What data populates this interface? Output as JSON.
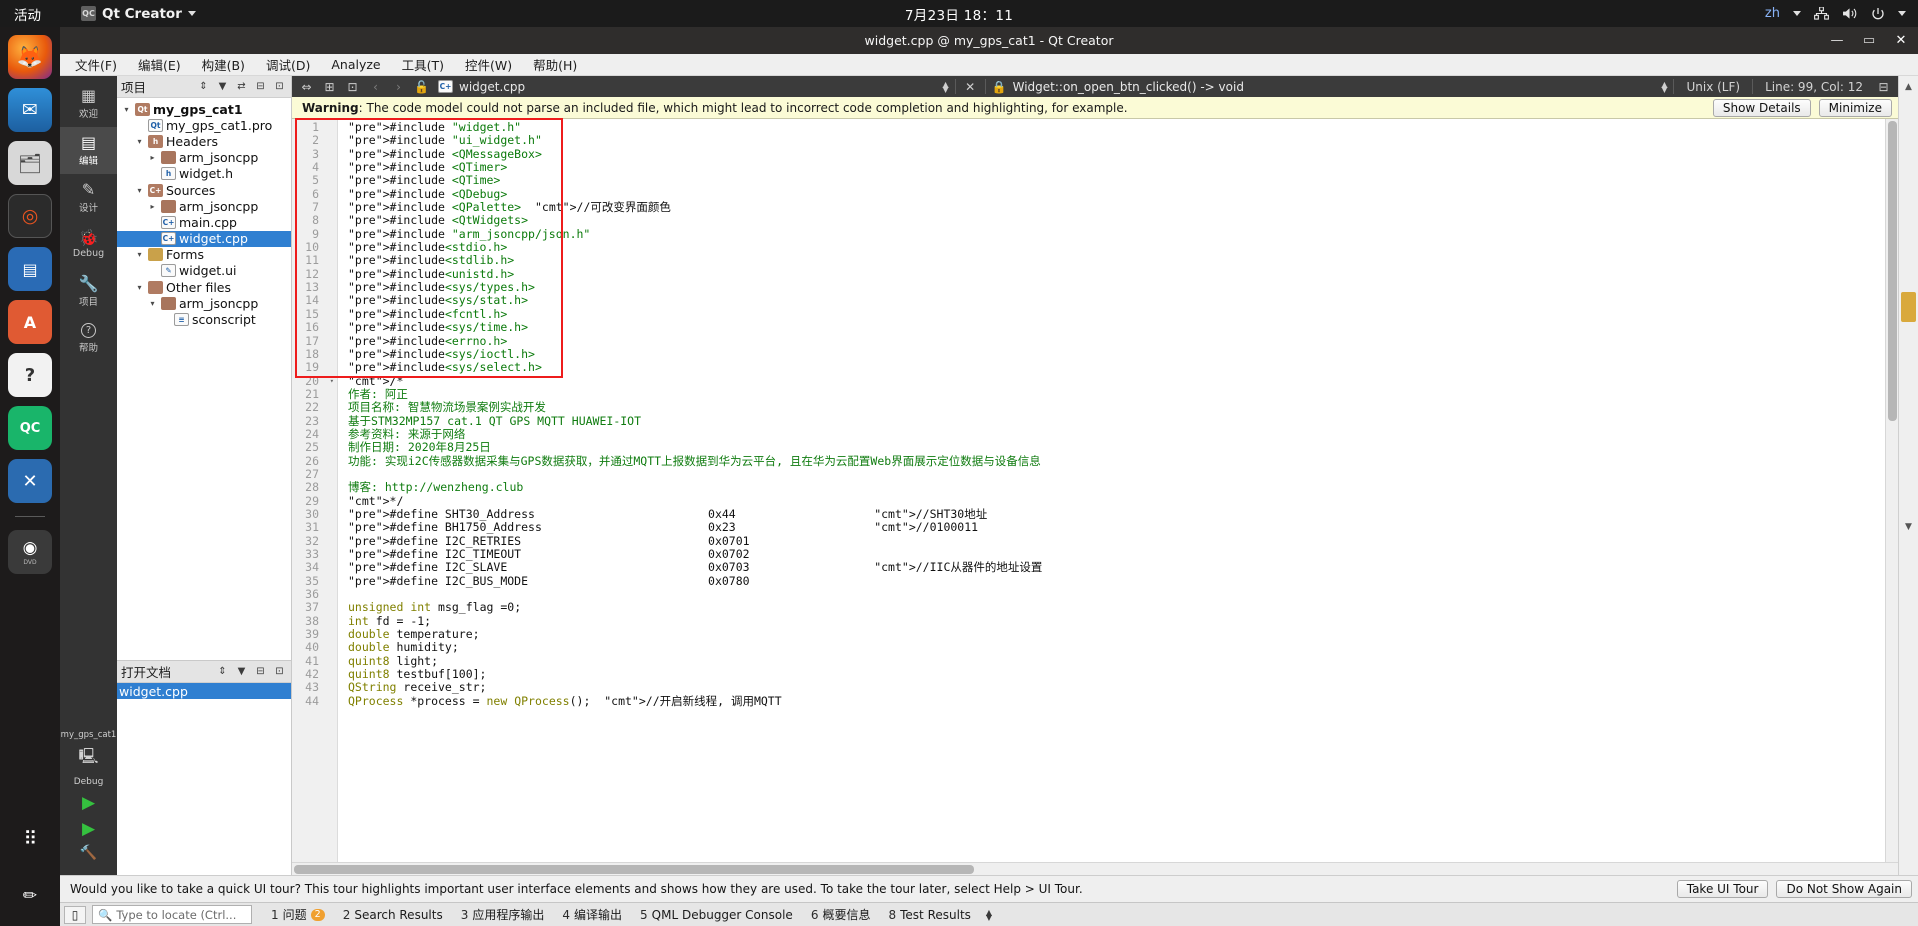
{
  "gnome": {
    "activities": "活动",
    "app_name": "Qt Creator",
    "app_badge": "QC",
    "clock": "7月23日  18：11",
    "language": "zh",
    "icons": [
      "network-icon",
      "volume-icon",
      "power-icon",
      "caret-down-icon"
    ]
  },
  "dock": {
    "items": [
      {
        "name": "firefox",
        "glyph": "🦊"
      },
      {
        "name": "thunderbird",
        "glyph": "✉"
      },
      {
        "name": "files",
        "glyph": "🗂"
      },
      {
        "name": "rhythmbox",
        "glyph": "◎"
      },
      {
        "name": "libreoffice-writer",
        "glyph": "📄"
      },
      {
        "name": "ubuntu-software",
        "glyph": "Ａ"
      },
      {
        "name": "help",
        "glyph": "?"
      },
      {
        "name": "qt-creator",
        "glyph": "QC"
      },
      {
        "name": "vscode",
        "glyph": "✕"
      },
      {
        "name": "dvd-drive",
        "glyph": "◉"
      },
      {
        "name": "show-applications",
        "glyph": "⠿"
      }
    ],
    "dvd_label": "DVD"
  },
  "window": {
    "title": "widget.cpp @ my_gps_cat1 - Qt Creator",
    "buttons": {
      "minimize": "—",
      "maximize": "▭",
      "close": "✕"
    }
  },
  "menubar": [
    {
      "label": "文件(F)",
      "key": "F"
    },
    {
      "label": "编辑(E)",
      "key": "E"
    },
    {
      "label": "构建(B)",
      "key": "B"
    },
    {
      "label": "调试(D)",
      "key": "D"
    },
    {
      "label": "Analyze",
      "key": "A"
    },
    {
      "label": "工具(T)",
      "key": "T"
    },
    {
      "label": "控件(W)",
      "key": "W"
    },
    {
      "label": "帮助(H)",
      "key": "H"
    }
  ],
  "modebar": [
    {
      "label": "欢迎",
      "glyph": "▦",
      "active": false
    },
    {
      "label": "编辑",
      "glyph": "▤",
      "active": true
    },
    {
      "label": "设计",
      "glyph": "✎",
      "active": false
    },
    {
      "label": "Debug",
      "glyph": "🐞",
      "active": false
    },
    {
      "label": "项目",
      "glyph": "🔧",
      "active": false
    },
    {
      "label": "帮助",
      "glyph": "?",
      "active": false
    }
  ],
  "project_panel": {
    "title": "项目",
    "header_icons": [
      "sort-icon",
      "filter-icon",
      "link-icon",
      "split-icon",
      "close-icon"
    ],
    "tree": [
      {
        "label": "my_gps_cat1",
        "indent": 0,
        "arrow": "▾",
        "icon": "folder",
        "icon_text": "Qt",
        "bold": true,
        "selected": false
      },
      {
        "label": "my_gps_cat1.pro",
        "indent": 1,
        "arrow": "",
        "icon": "file",
        "icon_text": "Qt",
        "bold": false,
        "selected": false
      },
      {
        "label": "Headers",
        "indent": 1,
        "arrow": "▾",
        "icon": "folder",
        "icon_text": "h",
        "bold": false,
        "selected": false
      },
      {
        "label": "arm_jsoncpp",
        "indent": 2,
        "arrow": "▸",
        "icon": "folder-plain",
        "icon_text": "",
        "bold": false,
        "selected": false
      },
      {
        "label": "widget.h",
        "indent": 2,
        "arrow": "",
        "icon": "file",
        "icon_text": "h",
        "bold": false,
        "selected": false
      },
      {
        "label": "Sources",
        "indent": 1,
        "arrow": "▾",
        "icon": "folder",
        "icon_text": "C+",
        "bold": false,
        "selected": false
      },
      {
        "label": "arm_jsoncpp",
        "indent": 2,
        "arrow": "▸",
        "icon": "folder-plain",
        "icon_text": "",
        "bold": false,
        "selected": false
      },
      {
        "label": "main.cpp",
        "indent": 2,
        "arrow": "",
        "icon": "file",
        "icon_text": "C+",
        "bold": false,
        "selected": false
      },
      {
        "label": "widget.cpp",
        "indent": 2,
        "arrow": "",
        "icon": "file",
        "icon_text": "C+",
        "bold": false,
        "selected": true
      },
      {
        "label": "Forms",
        "indent": 1,
        "arrow": "▾",
        "icon": "folder-form",
        "icon_text": "",
        "bold": false,
        "selected": false
      },
      {
        "label": "widget.ui",
        "indent": 2,
        "arrow": "",
        "icon": "file",
        "icon_text": "✎",
        "bold": false,
        "selected": false
      },
      {
        "label": "Other files",
        "indent": 1,
        "arrow": "▾",
        "icon": "folder",
        "icon_text": "",
        "bold": false,
        "selected": false
      },
      {
        "label": "arm_jsoncpp",
        "indent": 2,
        "arrow": "▾",
        "icon": "folder-plain",
        "icon_text": "",
        "bold": false,
        "selected": false
      },
      {
        "label": "sconscript",
        "indent": 3,
        "arrow": "",
        "icon": "file",
        "icon_text": "≡",
        "bold": false,
        "selected": false
      }
    ]
  },
  "opendocs_panel": {
    "title": "打开文档",
    "items": [
      {
        "label": "widget.cpp",
        "selected": true
      }
    ]
  },
  "editor_toolbar": {
    "file_name": "widget.cpp",
    "symbol": "Widget::on_open_btn_clicked() -> void",
    "line_ending": "Unix (LF)",
    "cursor": "Line: 99, Col: 12",
    "icons": [
      "link-icon",
      "split-horizontal-icon",
      "split-vertical-icon",
      "back-arrow-icon",
      "forward-arrow-icon",
      "lock-icon",
      "cpp-file-icon",
      "close-icon",
      "function-icon"
    ]
  },
  "warning_bar": {
    "prefix": "Warning",
    "message": ": The code model could not parse an included file, which might lead to incorrect code completion and highlighting, for example.",
    "show_details": "Show Details",
    "minimize": "Minimize",
    "show_details_mnemonic": "S",
    "minimize_mnemonic": "M"
  },
  "code": {
    "first_line": 1,
    "lines": [
      {
        "n": 1,
        "fold": "",
        "text": "#include \"widget.h\""
      },
      {
        "n": 2,
        "fold": "",
        "text": "#include \"ui_widget.h\""
      },
      {
        "n": 3,
        "fold": "",
        "text": "#include <QMessageBox>"
      },
      {
        "n": 4,
        "fold": "",
        "text": "#include <QTimer>"
      },
      {
        "n": 5,
        "fold": "",
        "text": "#include <QTime>"
      },
      {
        "n": 6,
        "fold": "",
        "text": "#include <QDebug>"
      },
      {
        "n": 7,
        "fold": "",
        "text": "#include <QPalette>  //可改变界面颜色"
      },
      {
        "n": 8,
        "fold": "",
        "text": "#include <QtWidgets>"
      },
      {
        "n": 9,
        "fold": "",
        "text": "#include \"arm_jsoncpp/json.h\""
      },
      {
        "n": 10,
        "fold": "",
        "text": "#include<stdio.h>"
      },
      {
        "n": 11,
        "fold": "",
        "text": "#include<stdlib.h>"
      },
      {
        "n": 12,
        "fold": "",
        "text": "#include<unistd.h>"
      },
      {
        "n": 13,
        "fold": "",
        "text": "#include<sys/types.h>"
      },
      {
        "n": 14,
        "fold": "",
        "text": "#include<sys/stat.h>"
      },
      {
        "n": 15,
        "fold": "",
        "text": "#include<fcntl.h>"
      },
      {
        "n": 16,
        "fold": "",
        "text": "#include<sys/time.h>"
      },
      {
        "n": 17,
        "fold": "",
        "text": "#include<errno.h>"
      },
      {
        "n": 18,
        "fold": "",
        "text": "#include<sys/ioctl.h>"
      },
      {
        "n": 19,
        "fold": "",
        "text": "#include<sys/select.h>"
      },
      {
        "n": 20,
        "fold": "▾",
        "text": "/*"
      },
      {
        "n": 21,
        "fold": "",
        "text": "作者: 阿正"
      },
      {
        "n": 22,
        "fold": "",
        "text": "项目名称: 智慧物流场景案例实战开发"
      },
      {
        "n": 23,
        "fold": "",
        "text": "基于STM32MP157 cat.1 QT GPS MQTT HUAWEI-IOT"
      },
      {
        "n": 24,
        "fold": "",
        "text": "参考资料: 来源于网络"
      },
      {
        "n": 25,
        "fold": "",
        "text": "制作日期: 2020年8月25日"
      },
      {
        "n": 26,
        "fold": "",
        "text": "功能: 实现i2C传感器数据采集与GPS数据获取，并通过MQTT上报数据到华为云平台, 且在华为云配置Web界面展示定位数据与设备信息"
      },
      {
        "n": 27,
        "fold": "",
        "text": ""
      },
      {
        "n": 28,
        "fold": "",
        "text": "博客: http://wenzheng.club"
      },
      {
        "n": 29,
        "fold": "",
        "text": "*/"
      },
      {
        "n": 30,
        "fold": "",
        "text": "#define SHT30_Address                         0x44                    //SHT30地址"
      },
      {
        "n": 31,
        "fold": "",
        "text": "#define BH1750_Address                        0x23                    //0100011"
      },
      {
        "n": 32,
        "fold": "",
        "text": "#define I2C_RETRIES                           0x0701"
      },
      {
        "n": 33,
        "fold": "",
        "text": "#define I2C_TIMEOUT                           0x0702"
      },
      {
        "n": 34,
        "fold": "",
        "text": "#define I2C_SLAVE                             0x0703                  //IIC从器件的地址设置"
      },
      {
        "n": 35,
        "fold": "",
        "text": "#define I2C_BUS_MODE                          0x0780"
      },
      {
        "n": 36,
        "fold": "",
        "text": ""
      },
      {
        "n": 37,
        "fold": "",
        "text": "unsigned int msg_flag =0;"
      },
      {
        "n": 38,
        "fold": "",
        "text": "int fd = -1;"
      },
      {
        "n": 39,
        "fold": "",
        "text": "double temperature;"
      },
      {
        "n": 40,
        "fold": "",
        "text": "double humidity;"
      },
      {
        "n": 41,
        "fold": "",
        "text": "quint8 light;"
      },
      {
        "n": 42,
        "fold": "",
        "text": "quint8 testbuf[100];"
      },
      {
        "n": 43,
        "fold": "",
        "text": "QString receive_str;"
      },
      {
        "n": 44,
        "fold": "",
        "text": "QProcess *process = new QProcess();  //开启新线程, 调用MQTT"
      }
    ],
    "highlight_box": {
      "from_line": 1,
      "to_line": 19,
      "color": "#ee1c1c"
    }
  },
  "tourbar": {
    "message": "Would you like to take a quick UI tour? This tour highlights important user interface elements and shows how they are used. To take the tour later, select Help > UI Tour.",
    "take_tour": "Take UI Tour",
    "dismiss": "Do Not Show Again"
  },
  "statusbar": {
    "locate_placeholder": "Type to locate (Ctrl...",
    "items": [
      {
        "num": "1",
        "label": "问题",
        "badge": "2"
      },
      {
        "num": "2",
        "label": "Search Results",
        "badge": ""
      },
      {
        "num": "3",
        "label": "应用程序输出",
        "badge": ""
      },
      {
        "num": "4",
        "label": "编译输出",
        "badge": ""
      },
      {
        "num": "5",
        "label": "QML Debugger Console",
        "badge": ""
      },
      {
        "num": "6",
        "label": "概要信息",
        "badge": ""
      },
      {
        "num": "8",
        "label": "Test Results",
        "badge": ""
      }
    ]
  },
  "kit_panel": {
    "project": "my_gps_cat1",
    "build_config": "Debug",
    "run_glyph": "▶",
    "debug_glyph": "▶",
    "build_glyph": "🔨"
  }
}
